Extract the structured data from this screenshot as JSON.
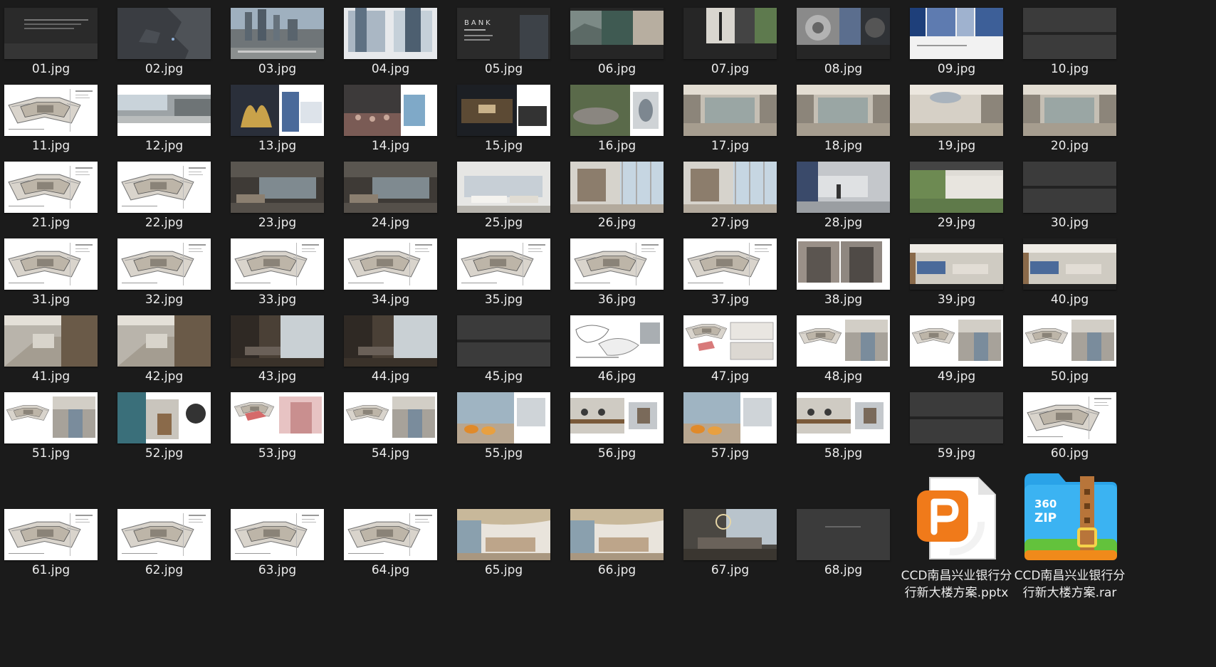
{
  "files": [
    {
      "name": "01.jpg",
      "kind": "dark"
    },
    {
      "name": "02.jpg",
      "kind": "map"
    },
    {
      "name": "03.jpg",
      "kind": "city"
    },
    {
      "name": "04.jpg",
      "kind": "towers"
    },
    {
      "name": "05.jpg",
      "kind": "bank"
    },
    {
      "name": "06.jpg",
      "kind": "mood"
    },
    {
      "name": "07.jpg",
      "kind": "mood2"
    },
    {
      "name": "08.jpg",
      "kind": "mood3"
    },
    {
      "name": "09.jpg",
      "kind": "blue"
    },
    {
      "name": "10.jpg",
      "kind": "blank"
    },
    {
      "name": "11.jpg",
      "kind": "plan"
    },
    {
      "name": "12.jpg",
      "kind": "street"
    },
    {
      "name": "13.jpg",
      "kind": "sculpture"
    },
    {
      "name": "14.jpg",
      "kind": "crowd"
    },
    {
      "name": "15.jpg",
      "kind": "night"
    },
    {
      "name": "16.jpg",
      "kind": "stone"
    },
    {
      "name": "17.jpg",
      "kind": "lobby"
    },
    {
      "name": "18.jpg",
      "kind": "lobby"
    },
    {
      "name": "19.jpg",
      "kind": "lobby2"
    },
    {
      "name": "20.jpg",
      "kind": "lobby"
    },
    {
      "name": "21.jpg",
      "kind": "plan"
    },
    {
      "name": "22.jpg",
      "kind": "plan"
    },
    {
      "name": "23.jpg",
      "kind": "lounge"
    },
    {
      "name": "24.jpg",
      "kind": "lounge"
    },
    {
      "name": "25.jpg",
      "kind": "bright"
    },
    {
      "name": "26.jpg",
      "kind": "window"
    },
    {
      "name": "27.jpg",
      "kind": "window"
    },
    {
      "name": "28.jpg",
      "kind": "grey"
    },
    {
      "name": "29.jpg",
      "kind": "green"
    },
    {
      "name": "30.jpg",
      "kind": "blank"
    },
    {
      "name": "31.jpg",
      "kind": "plan"
    },
    {
      "name": "32.jpg",
      "kind": "plan"
    },
    {
      "name": "33.jpg",
      "kind": "plan"
    },
    {
      "name": "34.jpg",
      "kind": "plan"
    },
    {
      "name": "35.jpg",
      "kind": "plan"
    },
    {
      "name": "36.jpg",
      "kind": "plan"
    },
    {
      "name": "37.jpg",
      "kind": "plan"
    },
    {
      "name": "38.jpg",
      "kind": "elevator"
    },
    {
      "name": "39.jpg",
      "kind": "office"
    },
    {
      "name": "40.jpg",
      "kind": "office"
    },
    {
      "name": "41.jpg",
      "kind": "hall"
    },
    {
      "name": "42.jpg",
      "kind": "hall"
    },
    {
      "name": "43.jpg",
      "kind": "lounge2"
    },
    {
      "name": "44.jpg",
      "kind": "lounge2"
    },
    {
      "name": "45.jpg",
      "kind": "blank"
    },
    {
      "name": "46.jpg",
      "kind": "sketch"
    },
    {
      "name": "47.jpg",
      "kind": "planpink"
    },
    {
      "name": "48.jpg",
      "kind": "planphoto"
    },
    {
      "name": "49.jpg",
      "kind": "planphoto"
    },
    {
      "name": "50.jpg",
      "kind": "planphoto"
    },
    {
      "name": "51.jpg",
      "kind": "planphoto"
    },
    {
      "name": "52.jpg",
      "kind": "teal"
    },
    {
      "name": "53.jpg",
      "kind": "pink"
    },
    {
      "name": "54.jpg",
      "kind": "planphoto"
    },
    {
      "name": "55.jpg",
      "kind": "orange"
    },
    {
      "name": "56.jpg",
      "kind": "cafe"
    },
    {
      "name": "57.jpg",
      "kind": "orange"
    },
    {
      "name": "58.jpg",
      "kind": "cafe"
    },
    {
      "name": "59.jpg",
      "kind": "blank"
    },
    {
      "name": "60.jpg",
      "kind": "plan"
    },
    {
      "name": "61.jpg",
      "kind": "plan"
    },
    {
      "name": "62.jpg",
      "kind": "plan"
    },
    {
      "name": "63.jpg",
      "kind": "plan"
    },
    {
      "name": "64.jpg",
      "kind": "plan"
    },
    {
      "name": "65.jpg",
      "kind": "curve"
    },
    {
      "name": "66.jpg",
      "kind": "curve"
    },
    {
      "name": "67.jpg",
      "kind": "dining"
    },
    {
      "name": "68.jpg",
      "kind": "blank2"
    },
    {
      "name": "CCD南昌兴业银行分行新大楼方案.pptx",
      "kind": "pptx"
    },
    {
      "name": "CCD南昌兴业银行分行新大楼方案.rar",
      "kind": "rar"
    }
  ],
  "icons": {
    "rar_badge_text": "360 ZIP"
  },
  "colors": {
    "background": "#1b1b1b",
    "pptx_orange": "#f07a1a",
    "zip_blue": "#2aa3e8",
    "zip_green": "#63c23c"
  }
}
